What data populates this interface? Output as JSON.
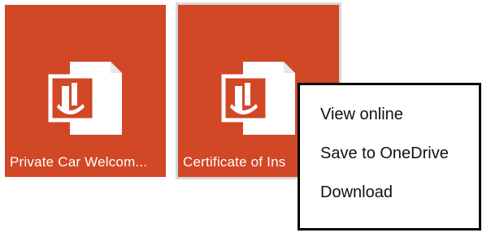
{
  "colors": {
    "tile_bg": "#d24726",
    "tile_selected_outline": "#d8d8d8",
    "menu_border": "#000000"
  },
  "tiles": [
    {
      "label": "Private Car Welcom...",
      "icon": "powerpoint-file-icon"
    },
    {
      "label": "Certificate of Ins",
      "icon": "powerpoint-file-icon"
    }
  ],
  "context_menu": {
    "items": [
      {
        "label": "View online"
      },
      {
        "label": "Save to OneDrive"
      },
      {
        "label": "Download"
      }
    ]
  }
}
